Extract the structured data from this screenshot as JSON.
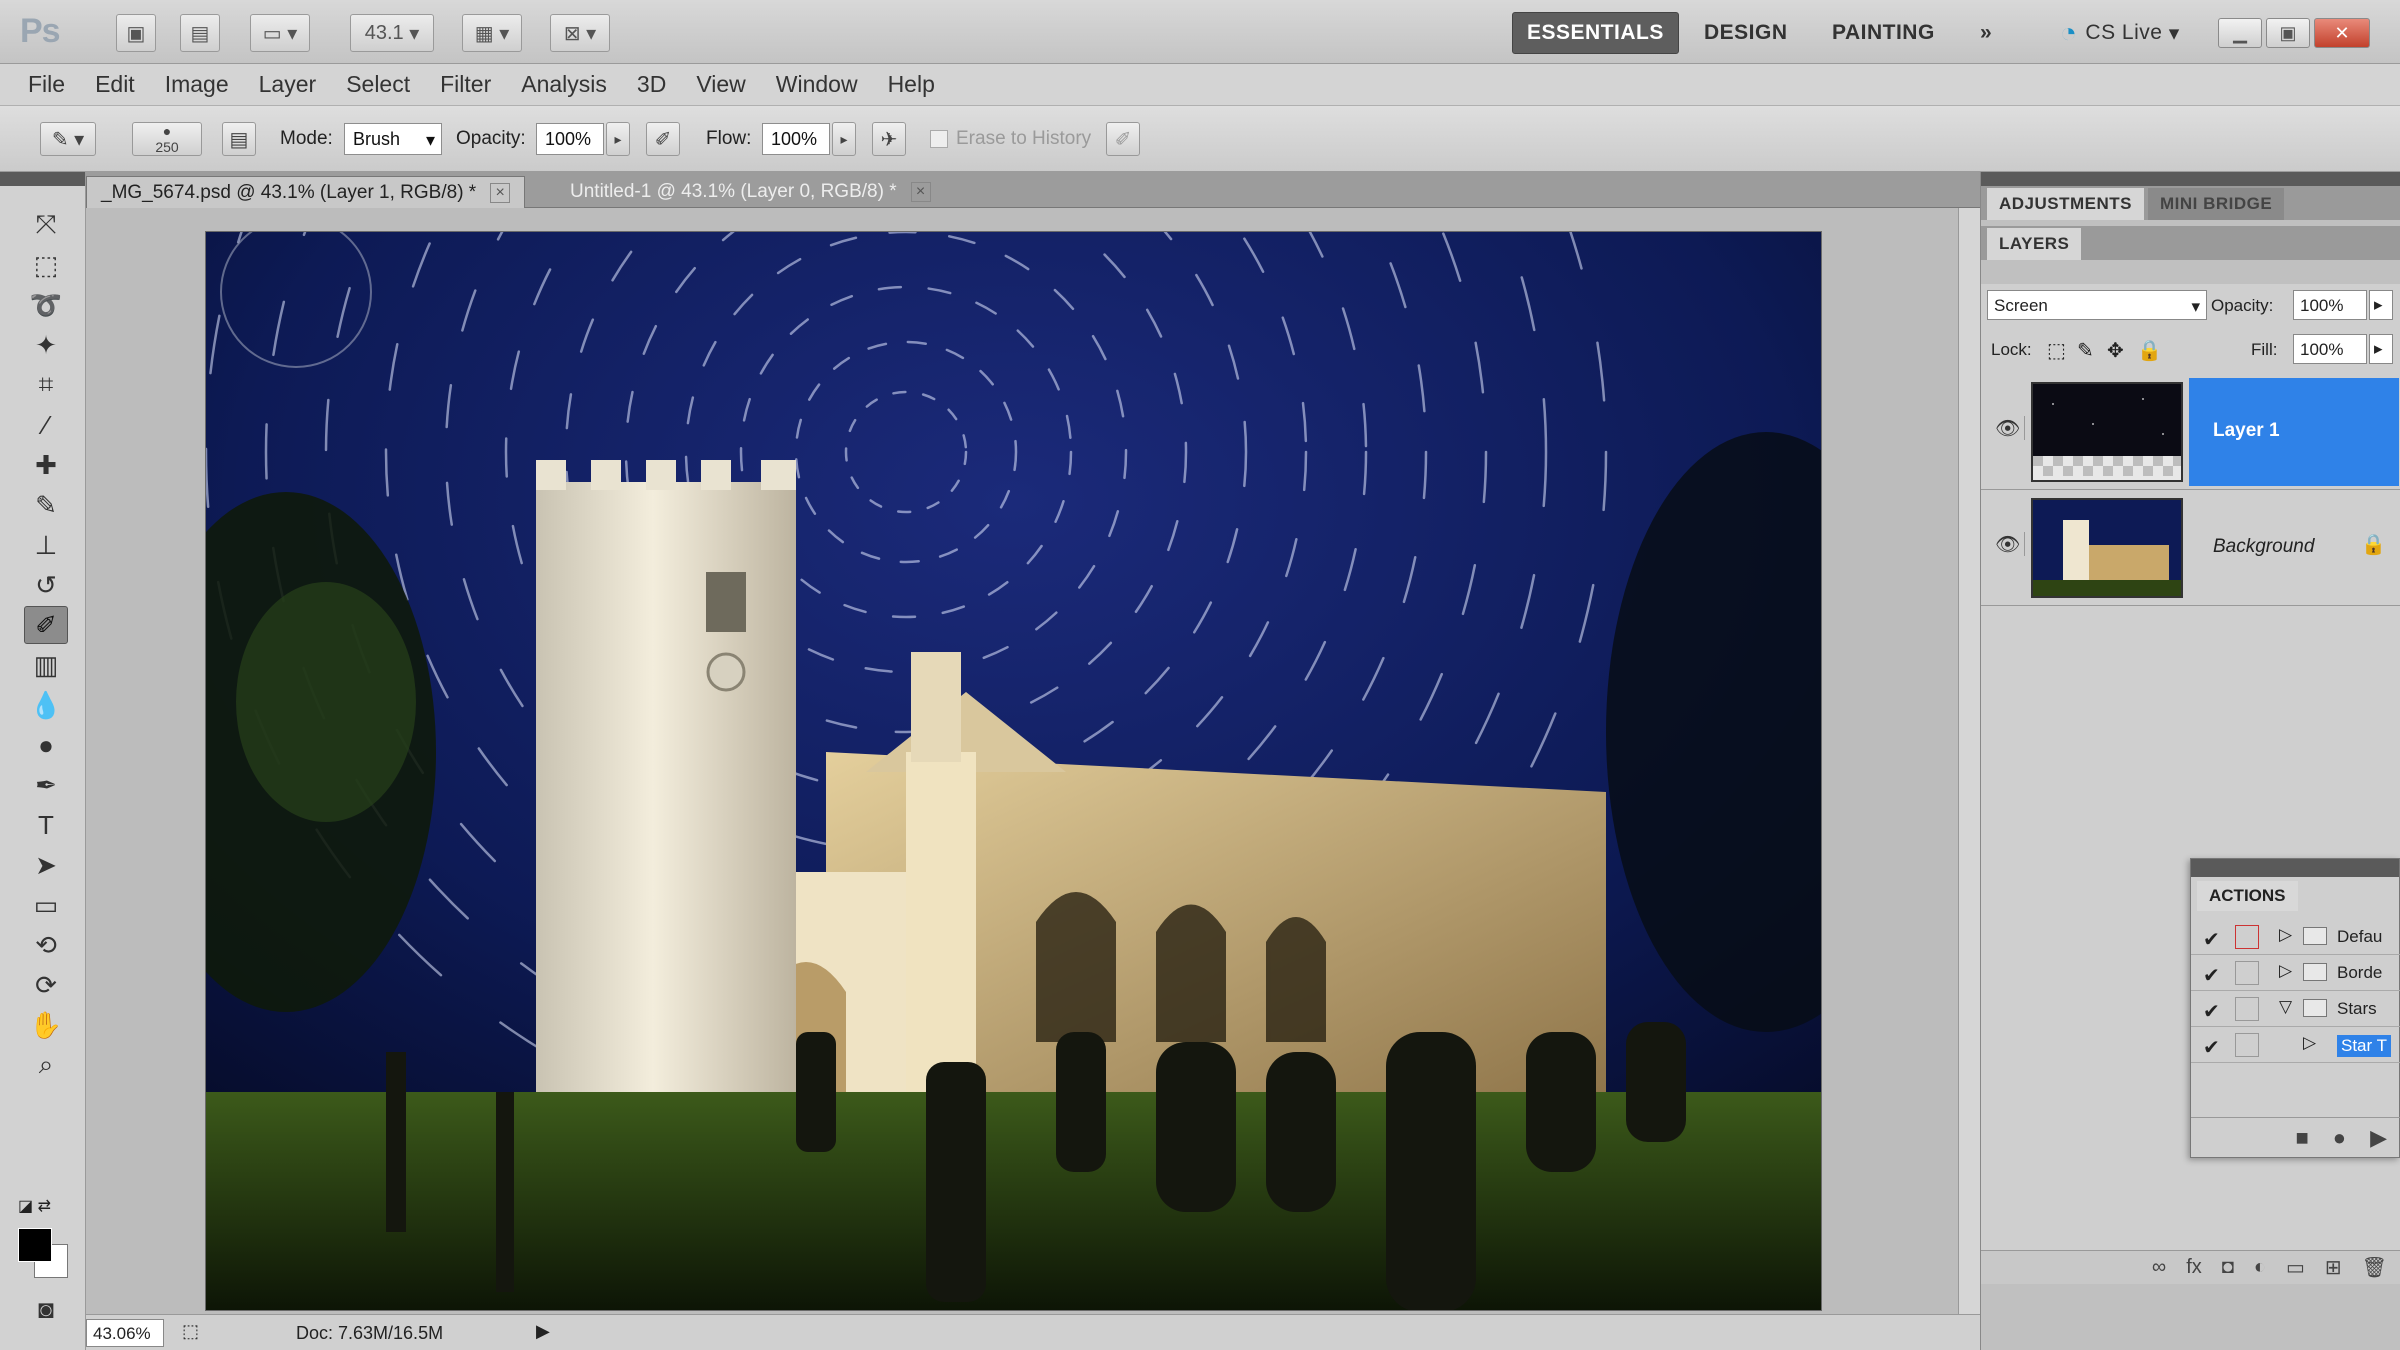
{
  "app": {
    "logo": "Ps",
    "zoom_dropdown": "43.1",
    "workspaces": [
      "ESSENTIALS",
      "DESIGN",
      "PAINTING"
    ],
    "more_workspaces": "»",
    "cs_live": "CS Live"
  },
  "menu": [
    "File",
    "Edit",
    "Image",
    "Layer",
    "Select",
    "Filter",
    "Analysis",
    "3D",
    "View",
    "Window",
    "Help"
  ],
  "options": {
    "brush_size": "250",
    "mode_label": "Mode:",
    "mode_value": "Brush",
    "opacity_label": "Opacity:",
    "opacity_value": "100%",
    "flow_label": "Flow:",
    "flow_value": "100%",
    "erase_history": "Erase to History"
  },
  "tabs": [
    {
      "label": "_MG_5674.psd @ 43.1% (Layer 1, RGB/8) *",
      "active": true
    },
    {
      "label": "Untitled-1 @ 43.1% (Layer 0, RGB/8) *",
      "active": false
    }
  ],
  "status": {
    "zoom": "43.06%",
    "doc": "Doc: 7.63M/16.5M"
  },
  "panels": {
    "top_tabs": [
      "ADJUSTMENTS",
      "MINI BRIDGE"
    ],
    "layers_tab": "LAYERS",
    "blend_mode": "Screen",
    "opacity_label": "Opacity:",
    "opacity_value": "100%",
    "lock_label": "Lock:",
    "fill_label": "Fill:",
    "fill_value": "100%",
    "layers": [
      {
        "name": "Layer 1",
        "selected": true
      },
      {
        "name": "Background",
        "selected": false
      }
    ]
  },
  "actions": {
    "tab": "ACTIONS",
    "rows": [
      {
        "name": "Defau",
        "dialog": true,
        "expanded": false,
        "folder": true
      },
      {
        "name": "Borde",
        "dialog": false,
        "expanded": false,
        "folder": true
      },
      {
        "name": "Stars",
        "dialog": false,
        "expanded": true,
        "folder": true
      },
      {
        "name": "Star T",
        "dialog": false,
        "expanded": false,
        "folder": false,
        "selected": true
      }
    ]
  },
  "colors": {
    "accent_blue": "#2f82e8",
    "panel_gray": "#cfcfcf",
    "sky": "#0d1a55",
    "tower_light": "#efe6d0"
  }
}
